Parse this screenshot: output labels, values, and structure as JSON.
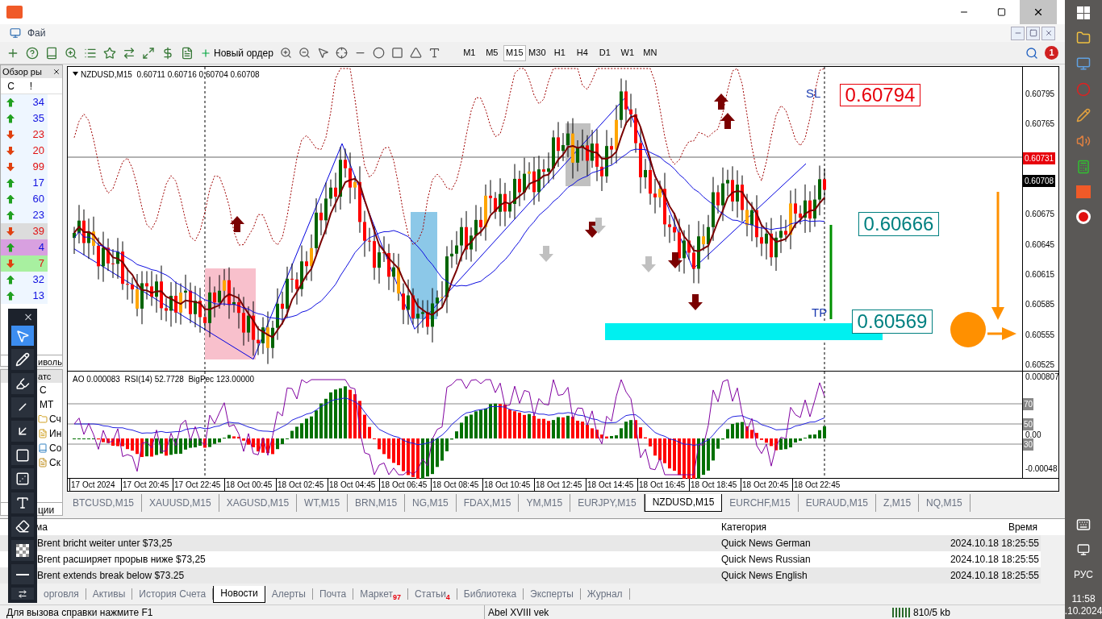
{
  "menu": {
    "visible_item": "Фай"
  },
  "toolbar": {
    "new_order": "Новый ордер",
    "notification_count": "1",
    "timeframes": [
      {
        "label": "M1",
        "selected": false
      },
      {
        "label": "M5",
        "selected": false
      },
      {
        "label": "M15",
        "selected": true
      },
      {
        "label": "M30",
        "selected": false
      },
      {
        "label": "H1",
        "selected": false
      },
      {
        "label": "H4",
        "selected": false
      },
      {
        "label": "D1",
        "selected": false
      },
      {
        "label": "W1",
        "selected": false
      },
      {
        "label": "MN",
        "selected": false
      }
    ]
  },
  "market_watch": {
    "title": "Обзор ры",
    "columns": [
      "С",
      "!"
    ],
    "tab": "иволь",
    "rows": [
      {
        "kind": "up",
        "value": "34"
      },
      {
        "kind": "up",
        "value": "35"
      },
      {
        "kind": "down",
        "value": "23"
      },
      {
        "kind": "down",
        "value": "20"
      },
      {
        "kind": "down",
        "value": "99"
      },
      {
        "kind": "up",
        "value": "17"
      },
      {
        "kind": "up",
        "value": "60"
      },
      {
        "kind": "up",
        "value": "23"
      },
      {
        "kind": "down",
        "value": "39",
        "color": "#dcdcdc"
      },
      {
        "kind": "up",
        "value": "4",
        "color": "#d8a0e0"
      },
      {
        "kind": "down",
        "value": "7",
        "color": "#a8f0a0"
      },
      {
        "kind": "up",
        "value": "32"
      },
      {
        "kind": "up",
        "value": "13"
      }
    ]
  },
  "navigator": {
    "title": "атс",
    "root": "С МТ",
    "tab": "ции",
    "items": [
      {
        "label": "Сч",
        "kind": "accounts"
      },
      {
        "label": "Ин",
        "kind": "indicators"
      },
      {
        "label": "Со",
        "kind": "experts"
      },
      {
        "label": "Ск",
        "kind": "scripts"
      }
    ]
  },
  "drawing_tools": [
    {
      "kind": "cursor",
      "selected": true
    },
    {
      "kind": "pencil",
      "selected": false
    },
    {
      "kind": "marker",
      "selected": false
    },
    {
      "kind": "line",
      "selected": false
    },
    {
      "kind": "arrow",
      "selected": false
    },
    {
      "kind": "rectangle",
      "selected": false
    },
    {
      "kind": "numbers",
      "selected": false
    },
    {
      "kind": "text",
      "selected": false
    },
    {
      "kind": "eraser",
      "selected": false
    },
    {
      "kind": "opacity",
      "selected": false
    },
    {
      "kind": "thickness",
      "selected": false
    }
  ],
  "chart": {
    "header": "NZDUSD,M15  0.60711 0.60716 0.60704 0.60708",
    "price_ticks": [
      "0.60795",
      "0.60765",
      "0.60675",
      "0.60645",
      "0.60615",
      "0.60585",
      "0.60555",
      "0.60525"
    ],
    "bid_label": "0.60731",
    "last_label": "0.60708",
    "sl": {
      "label": "SL",
      "value": "0.60794"
    },
    "entry": {
      "value": "0.60666"
    },
    "tp": {
      "label": "TP",
      "value": "0.60569"
    },
    "indicator_header": "AO 0.000083  RSI(14) 52.7728  BigPec 123.00000",
    "indicator_ticks": [
      {
        "label": "0.000807",
        "kind": "value"
      },
      {
        "label": "70",
        "kind": "level"
      },
      {
        "label": "50",
        "kind": "level"
      },
      {
        "label": "0.00",
        "kind": "value"
      },
      {
        "label": "30",
        "kind": "level"
      },
      {
        "label": "-0.00048",
        "kind": "value"
      }
    ],
    "time_labels": [
      "17 Oct 2024",
      "17 Oct 20:45",
      "17 Oct 22:45",
      "18 Oct 00:45",
      "18 Oct 02:45",
      "18 Oct 04:45",
      "18 Oct 06:45",
      "18 Oct 08:45",
      "18 Oct 10:45",
      "18 Oct 12:45",
      "18 Oct 14:45",
      "18 Oct 16:45",
      "18 Oct 18:45",
      "18 Oct 20:45",
      "18 Oct 22:45"
    ]
  },
  "chart_tabs": [
    {
      "label": "BTCUSD,M15",
      "selected": false
    },
    {
      "label": "XAUUSD,M15",
      "selected": false
    },
    {
      "label": "XAGUSD,M15",
      "selected": false
    },
    {
      "label": "WT,M15",
      "selected": false
    },
    {
      "label": "BRN,M15",
      "selected": false
    },
    {
      "label": "NG,M15",
      "selected": false
    },
    {
      "label": "FDAX,M15",
      "selected": false
    },
    {
      "label": "YM,M15",
      "selected": false
    },
    {
      "label": "EURJPY,M15",
      "selected": false
    },
    {
      "label": "NZDUSD,M15",
      "selected": true
    },
    {
      "label": "EURCHF,M15",
      "selected": false
    },
    {
      "label": "EURAUD,M15",
      "selected": false
    },
    {
      "label": "Z,M15",
      "selected": false
    },
    {
      "label": "NQ,M15",
      "selected": false
    }
  ],
  "news": {
    "columns": [
      "ма",
      "Категория",
      "Время"
    ],
    "rows": [
      {
        "subject": "Brent bricht weiter unter $73,25",
        "category": "Quick News German",
        "time": "2024.10.18 18:25:55"
      },
      {
        "subject": "Brent расширяет прорыв ниже $73,25",
        "category": "Quick News Russian",
        "time": "2024.10.18 18:25:55"
      },
      {
        "subject": "Brent extends break below $73.25",
        "category": "Quick News English",
        "time": "2024.10.18 18:25:55"
      }
    ]
  },
  "terminal_tabs": [
    {
      "label": "орговля",
      "selected": false
    },
    {
      "label": "Активы",
      "selected": false
    },
    {
      "label": "История Счета",
      "selected": false
    },
    {
      "label": "Новости",
      "selected": true
    },
    {
      "label": "Алерты",
      "selected": false
    },
    {
      "label": "Почта",
      "selected": false
    },
    {
      "label": "Маркет",
      "badge": "97",
      "selected": false
    },
    {
      "label": "Статьи",
      "badge": "4",
      "selected": false
    },
    {
      "label": "Библиотека",
      "selected": false
    },
    {
      "label": "Эксперты",
      "selected": false
    },
    {
      "label": "Журнал",
      "selected": false
    }
  ],
  "status_bar": {
    "help": "Для вызова справки нажмите F1",
    "profile": "Abel XVIII vek",
    "traffic": "810/5 kb"
  },
  "taskbar": {
    "language": "РУС",
    "time": "11:58",
    "date": ".10.2024"
  }
}
